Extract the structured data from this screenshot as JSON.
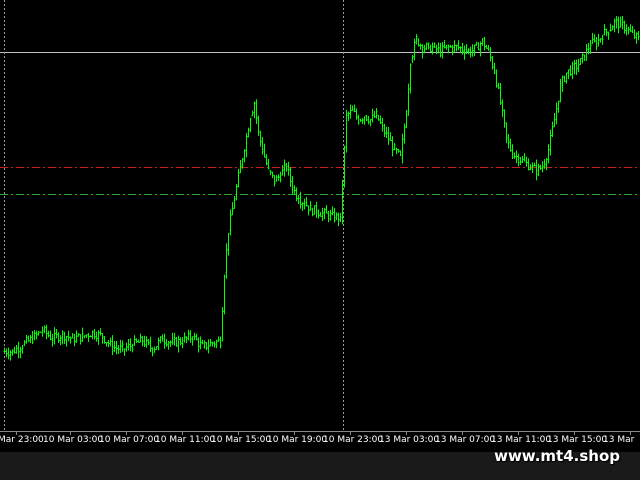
{
  "watermark": "www.mt4.shop",
  "colors": {
    "background": "#000000",
    "candle": "#00ff00",
    "grid": "#c0c0c0",
    "level_red": "#c81e1e",
    "level_green": "#2fa82f",
    "axis_text": "#ffffff",
    "bottom_bar": "#1a1a1a"
  },
  "chart_data": {
    "type": "line",
    "style": "ohlc-bars",
    "title": "",
    "xlabel": "",
    "ylabel": "",
    "grid": false,
    "ylim": [
      0,
      100
    ],
    "x_ticks": [
      "Mar 23:00",
      "10 Mar 03:00",
      "10 Mar 07:00",
      "10 Mar 11:00",
      "10 Mar 15:00",
      "10 Mar 19:00",
      "10 Mar 23:00",
      "13 Mar 03:00",
      "13 Mar 07:00",
      "13 Mar 11:00",
      "13 Mar 15:00",
      "13 Mar"
    ],
    "reference_lines": [
      {
        "kind": "horizontal",
        "style": "solid",
        "value": 89
      },
      {
        "kind": "horizontal",
        "style": "dash-dot",
        "color": "red",
        "value": 62
      },
      {
        "kind": "horizontal",
        "style": "dash-dot",
        "color": "green",
        "value": 55.5
      },
      {
        "kind": "vertical",
        "style": "dotted",
        "at_tick": "Mar 23:00"
      },
      {
        "kind": "vertical",
        "style": "dotted",
        "at_tick": "10 Mar 23:00"
      }
    ],
    "series": [
      {
        "values": [
          {
            "x": 0,
            "y": 18.5
          },
          {
            "x": 10,
            "y": 18.5
          },
          {
            "x": 20,
            "y": 20
          },
          {
            "x": 30,
            "y": 21.5
          },
          {
            "x": 40,
            "y": 23.5
          },
          {
            "x": 50,
            "y": 21.5
          },
          {
            "x": 60,
            "y": 22.5
          },
          {
            "x": 70,
            "y": 21.5
          },
          {
            "x": 80,
            "y": 22
          },
          {
            "x": 90,
            "y": 23
          },
          {
            "x": 100,
            "y": 22
          },
          {
            "x": 110,
            "y": 19.5
          },
          {
            "x": 120,
            "y": 19
          },
          {
            "x": 130,
            "y": 20
          },
          {
            "x": 140,
            "y": 21
          },
          {
            "x": 150,
            "y": 19
          },
          {
            "x": 160,
            "y": 21.5
          },
          {
            "x": 170,
            "y": 20.5
          },
          {
            "x": 180,
            "y": 21
          },
          {
            "x": 190,
            "y": 22
          },
          {
            "x": 200,
            "y": 19.5
          },
          {
            "x": 210,
            "y": 20.5
          },
          {
            "x": 218,
            "y": 21
          },
          {
            "x": 222,
            "y": 37
          },
          {
            "x": 226,
            "y": 47
          },
          {
            "x": 232,
            "y": 54.5
          },
          {
            "x": 238,
            "y": 62
          },
          {
            "x": 244,
            "y": 69
          },
          {
            "x": 248,
            "y": 74
          },
          {
            "x": 252,
            "y": 77
          },
          {
            "x": 256,
            "y": 70
          },
          {
            "x": 260,
            "y": 66
          },
          {
            "x": 266,
            "y": 61
          },
          {
            "x": 272,
            "y": 58.5
          },
          {
            "x": 278,
            "y": 60
          },
          {
            "x": 284,
            "y": 62
          },
          {
            "x": 290,
            "y": 57
          },
          {
            "x": 296,
            "y": 54.5
          },
          {
            "x": 302,
            "y": 53.5
          },
          {
            "x": 308,
            "y": 52
          },
          {
            "x": 314,
            "y": 51.5
          },
          {
            "x": 320,
            "y": 51
          },
          {
            "x": 326,
            "y": 50.5
          },
          {
            "x": 332,
            "y": 50
          },
          {
            "x": 338,
            "y": 50
          },
          {
            "x": 344,
            "y": 74
          },
          {
            "x": 350,
            "y": 75
          },
          {
            "x": 356,
            "y": 73
          },
          {
            "x": 362,
            "y": 74
          },
          {
            "x": 368,
            "y": 73
          },
          {
            "x": 374,
            "y": 74
          },
          {
            "x": 380,
            "y": 71
          },
          {
            "x": 386,
            "y": 68.5
          },
          {
            "x": 392,
            "y": 66
          },
          {
            "x": 398,
            "y": 64
          },
          {
            "x": 404,
            "y": 75
          },
          {
            "x": 408,
            "y": 87
          },
          {
            "x": 414,
            "y": 92
          },
          {
            "x": 420,
            "y": 90
          },
          {
            "x": 426,
            "y": 90
          },
          {
            "x": 432,
            "y": 90
          },
          {
            "x": 438,
            "y": 89
          },
          {
            "x": 444,
            "y": 90
          },
          {
            "x": 450,
            "y": 90
          },
          {
            "x": 456,
            "y": 90
          },
          {
            "x": 462,
            "y": 89.5
          },
          {
            "x": 468,
            "y": 89
          },
          {
            "x": 474,
            "y": 90
          },
          {
            "x": 480,
            "y": 91.5
          },
          {
            "x": 486,
            "y": 89
          },
          {
            "x": 492,
            "y": 84.5
          },
          {
            "x": 498,
            "y": 77
          },
          {
            "x": 504,
            "y": 68.5
          },
          {
            "x": 510,
            "y": 65
          },
          {
            "x": 516,
            "y": 64
          },
          {
            "x": 522,
            "y": 63
          },
          {
            "x": 528,
            "y": 62
          },
          {
            "x": 534,
            "y": 61
          },
          {
            "x": 540,
            "y": 62
          },
          {
            "x": 546,
            "y": 66
          },
          {
            "x": 552,
            "y": 73
          },
          {
            "x": 558,
            "y": 81
          },
          {
            "x": 564,
            "y": 84
          },
          {
            "x": 570,
            "y": 85
          },
          {
            "x": 576,
            "y": 86
          },
          {
            "x": 582,
            "y": 88
          },
          {
            "x": 588,
            "y": 91
          },
          {
            "x": 594,
            "y": 91
          },
          {
            "x": 600,
            "y": 93
          },
          {
            "x": 606,
            "y": 94
          },
          {
            "x": 612,
            "y": 96
          },
          {
            "x": 618,
            "y": 95.5
          },
          {
            "x": 624,
            "y": 94.5
          },
          {
            "x": 630,
            "y": 93
          },
          {
            "x": 636,
            "y": 92
          }
        ]
      }
    ]
  }
}
